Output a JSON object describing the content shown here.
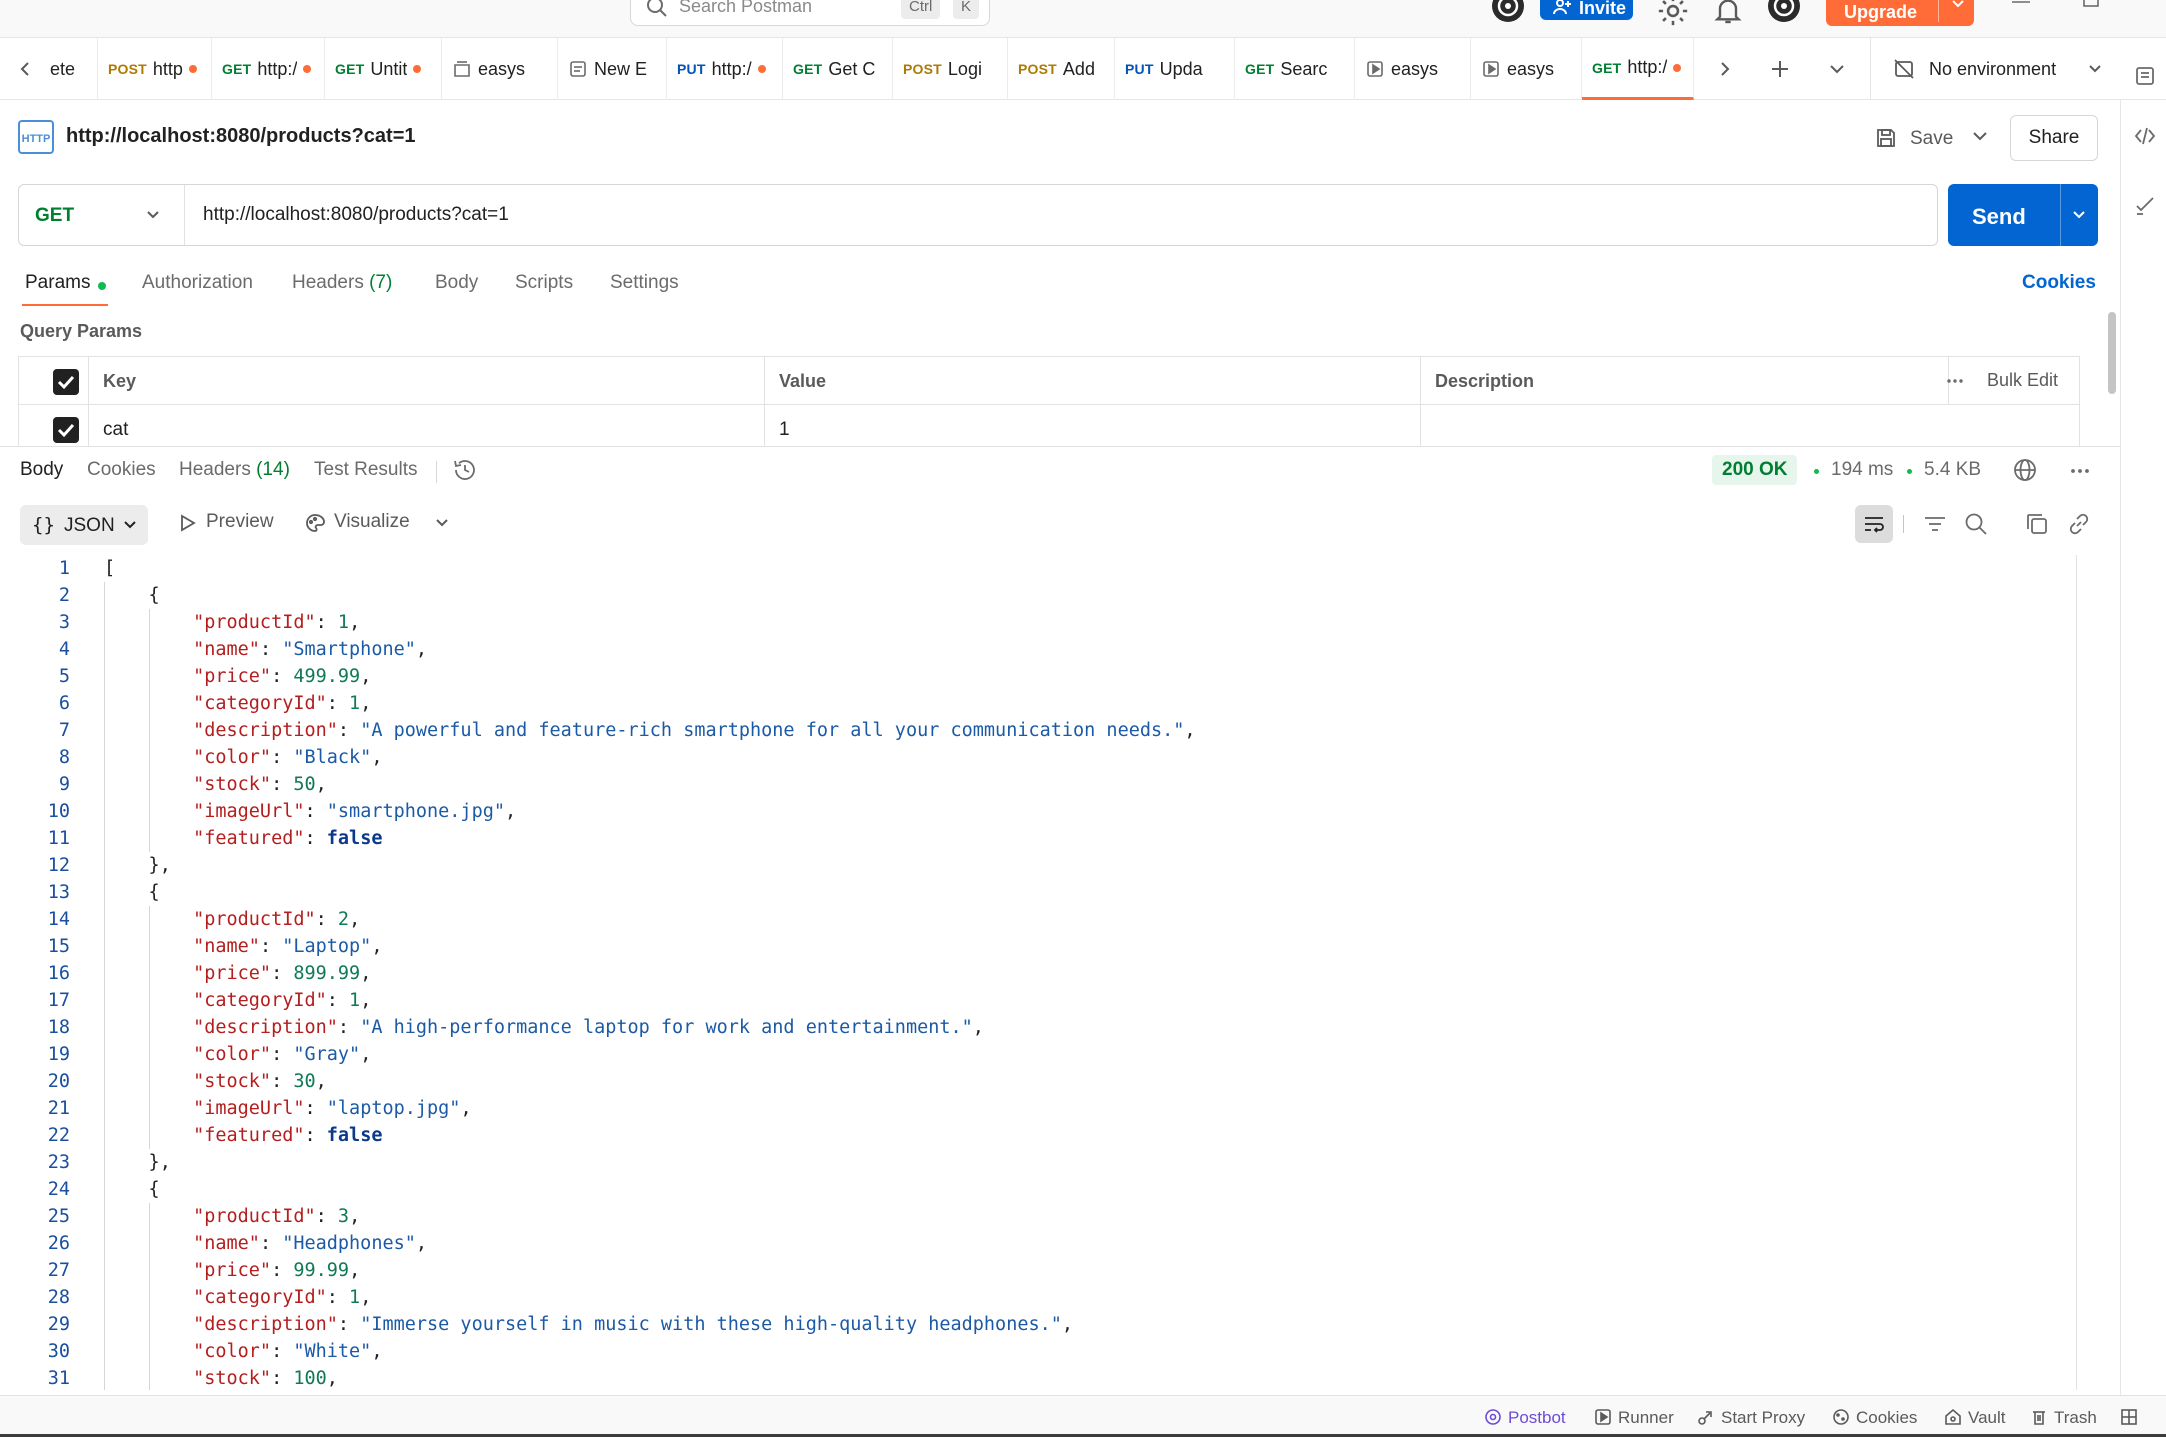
{
  "topbar": {
    "search_placeholder": "Search Postman",
    "shortcut_ctrl": "Ctrl",
    "shortcut_key": "K",
    "invite_label": "Invite",
    "upgrade_label": "Upgrade"
  },
  "tabs": [
    {
      "method": "",
      "name": "ete",
      "dot": false,
      "icon": ""
    },
    {
      "method": "POST",
      "name": "http",
      "dot": true,
      "icon": ""
    },
    {
      "method": "GET",
      "name": "http:/",
      "dot": true,
      "icon": ""
    },
    {
      "method": "GET",
      "name": "Untit",
      "dot": true,
      "icon": ""
    },
    {
      "method": "",
      "name": "easys",
      "dot": false,
      "icon": "collection-icon"
    },
    {
      "method": "",
      "name": "New E",
      "dot": false,
      "icon": "environment-icon"
    },
    {
      "method": "PUT",
      "name": "http:/",
      "dot": true,
      "icon": ""
    },
    {
      "method": "GET",
      "name": "Get C",
      "dot": false,
      "icon": ""
    },
    {
      "method": "POST",
      "name": "Logi",
      "dot": false,
      "icon": ""
    },
    {
      "method": "POST",
      "name": "Add",
      "dot": false,
      "icon": ""
    },
    {
      "method": "PUT",
      "name": "Upda",
      "dot": false,
      "icon": ""
    },
    {
      "method": "GET",
      "name": "Searc",
      "dot": false,
      "icon": ""
    },
    {
      "method": "",
      "name": "easys",
      "dot": false,
      "icon": "runner-icon"
    },
    {
      "method": "",
      "name": "easys",
      "dot": false,
      "icon": "runner-icon"
    },
    {
      "method": "GET",
      "name": "http:/",
      "dot": true,
      "icon": "",
      "active": true
    }
  ],
  "environment": {
    "label": "No environment"
  },
  "request": {
    "title": "http://localhost:8080/products?cat=1",
    "save_label": "Save",
    "share_label": "Share",
    "method": "GET",
    "url": "http://localhost:8080/products?cat=1",
    "send_label": "Send"
  },
  "request_tabs": {
    "params": "Params",
    "authorization": "Authorization",
    "headers": "Headers",
    "headers_count": "(7)",
    "body": "Body",
    "scripts": "Scripts",
    "settings": "Settings",
    "cookies": "Cookies"
  },
  "query_params": {
    "section_label": "Query Params",
    "columns": {
      "key": "Key",
      "value": "Value",
      "description": "Description"
    },
    "bulk_edit": "Bulk Edit",
    "rows": [
      {
        "key": "cat",
        "value": "1",
        "description": "",
        "checked": true
      }
    ]
  },
  "response_tabs": {
    "body": "Body",
    "cookies": "Cookies",
    "headers": "Headers",
    "headers_count": "(14)",
    "test_results": "Test Results"
  },
  "response_meta": {
    "status": "200 OK",
    "time": "194 ms",
    "size": "5.4 KB"
  },
  "response_toolbar": {
    "format": "JSON",
    "preview": "Preview",
    "visualize": "Visualize"
  },
  "code_lines": [
    "[",
    "    {",
    "        \"productId\": 1,",
    "        \"name\": \"Smartphone\",",
    "        \"price\": 499.99,",
    "        \"categoryId\": 1,",
    "        \"description\": \"A powerful and feature-rich smartphone for all your communication needs.\",",
    "        \"color\": \"Black\",",
    "        \"stock\": 50,",
    "        \"imageUrl\": \"smartphone.jpg\",",
    "        \"featured\": false",
    "    },",
    "    {",
    "        \"productId\": 2,",
    "        \"name\": \"Laptop\",",
    "        \"price\": 899.99,",
    "        \"categoryId\": 1,",
    "        \"description\": \"A high-performance laptop for work and entertainment.\",",
    "        \"color\": \"Gray\",",
    "        \"stock\": 30,",
    "        \"imageUrl\": \"laptop.jpg\",",
    "        \"featured\": false",
    "    },",
    "    {",
    "        \"productId\": 3,",
    "        \"name\": \"Headphones\",",
    "        \"price\": 99.99,",
    "        \"categoryId\": 1,",
    "        \"description\": \"Immerse yourself in music with these high-quality headphones.\",",
    "        \"color\": \"White\",",
    "        \"stock\": 100,"
  ],
  "footer": {
    "postbot": "Postbot",
    "runner": "Runner",
    "start_proxy": "Start Proxy",
    "cookies": "Cookies",
    "vault": "Vault",
    "trash": "Trash"
  },
  "colors": {
    "accent": "#ff6c37",
    "primary": "#0265d2",
    "get": "#007f31",
    "post": "#ad7a03",
    "put": "#0053b8",
    "json_key": "#b41e1e",
    "json_string": "#1b5aa6",
    "json_number": "#0f7a55"
  }
}
